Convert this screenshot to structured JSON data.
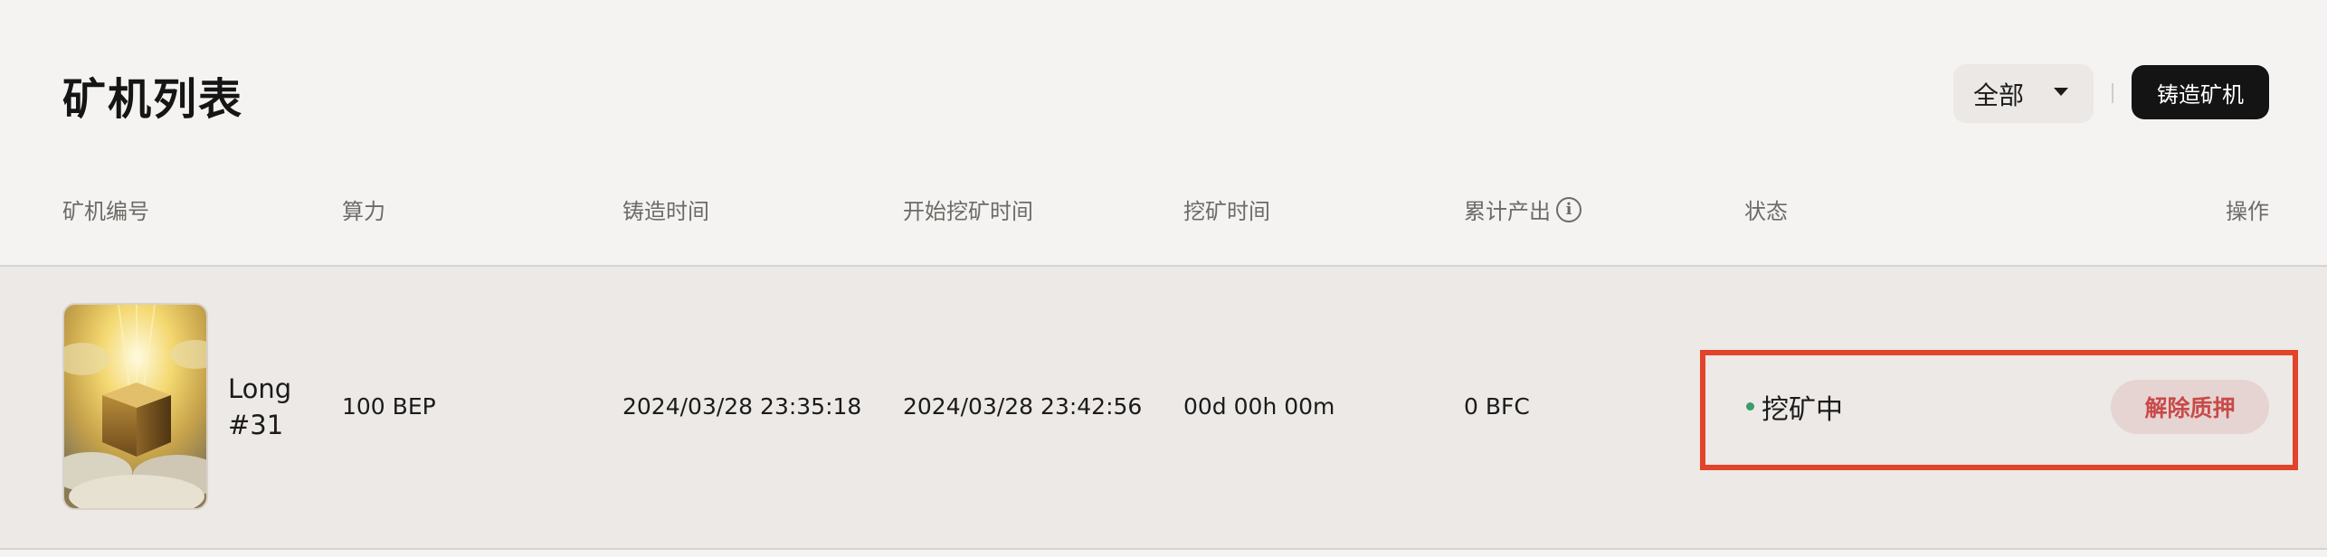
{
  "header": {
    "title": "矿机列表",
    "filter_selected": "全部",
    "mint_label": "铸造矿机"
  },
  "table": {
    "columns": {
      "id": "矿机编号",
      "hashrate": "算力",
      "minted_at": "铸造时间",
      "mining_started_at": "开始挖矿时间",
      "mining_time": "挖矿时间",
      "total_output": "累计产出",
      "status": "状态",
      "actions": "操作"
    },
    "rows": [
      {
        "name_line1": "Long",
        "name_line2": "#31",
        "hashrate": "100 BEP",
        "minted_at": "2024/03/28 23:35:18",
        "mining_started_at": "2024/03/28 23:42:56",
        "mining_time": "00d 00h 00m",
        "total_output": "0 BFC",
        "status": "挖矿中",
        "status_color": "#3d9c6a",
        "action_label": "解除质押"
      }
    ]
  },
  "icons": {
    "info": "info-circle-icon",
    "caret": "caret-down-icon"
  },
  "colors": {
    "page_bg": "#f5f3f1",
    "row_bg": "#ece9e6",
    "primary_button_bg": "#141414",
    "danger_text": "#c84a48",
    "danger_bg": "#e6d4d3",
    "highlight_border": "#e2432b"
  }
}
